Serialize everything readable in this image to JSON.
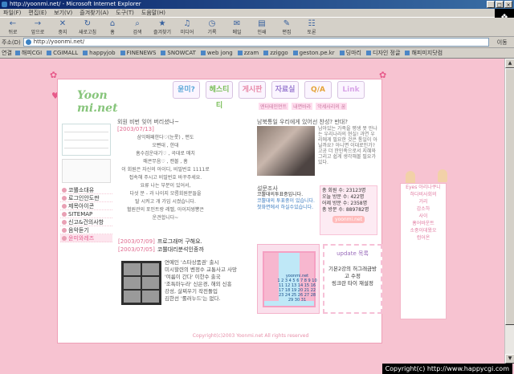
{
  "window": {
    "title": "http://yoonmi.net/ - Microsoft Internet Explorer"
  },
  "menus": [
    "파일(F)",
    "편집(E)",
    "보기(V)",
    "즐겨찾기(A)",
    "도구(T)",
    "도움말(H)"
  ],
  "toolbar": [
    {
      "label": "뒤로",
      "icon": "back-arrow-icon"
    },
    {
      "label": "앞으로",
      "icon": "forward-arrow-icon"
    },
    {
      "label": "중지",
      "icon": "stop-icon"
    },
    {
      "label": "새로고침",
      "icon": "refresh-icon"
    },
    {
      "label": "홈",
      "icon": "home-icon"
    },
    {
      "label": "검색",
      "icon": "search-icon"
    },
    {
      "label": "즐겨찾기",
      "icon": "favorites-icon"
    },
    {
      "label": "미디어",
      "icon": "media-icon"
    },
    {
      "label": "기록",
      "icon": "history-icon"
    },
    {
      "label": "메일",
      "icon": "mail-icon"
    },
    {
      "label": "인쇄",
      "icon": "print-icon"
    },
    {
      "label": "편집",
      "icon": "edit-icon"
    },
    {
      "label": "토론",
      "icon": "discuss-icon"
    }
  ],
  "address": {
    "label": "주소(D)",
    "value": "http://yoonmi.net/",
    "go": "이동"
  },
  "links": {
    "label": "연결",
    "items": [
      "해피CGI",
      "CGIMALL",
      "happyjob",
      "FINENEWS",
      "SNOWCAT",
      "web jong",
      "zzam",
      "zziggo",
      "geston.pe.kr",
      "딩마리",
      "디자인 정글",
      "해피미지닷컴"
    ]
  },
  "site": {
    "logo": "Yoon mi.net",
    "nav": [
      "윤미?",
      "헤스티티",
      "게시판",
      "자료실",
      "Q/A",
      "Link"
    ],
    "subnav": [
      "엔터테인먼트",
      "내면바라",
      "악세사리의 꿈"
    ],
    "menu": [
      "코뿔소대유",
      "로그인안도판",
      "제목아이콘",
      "SITEMAP",
      "신고&건의사항",
      "음악듣기",
      "윤미와레즈"
    ],
    "news": {
      "title": "외원 비번 잊어 버리셨나~",
      "date": "[2003/07/13]",
      "lines": [
        "삼익매패한다♡(눈롯) , 편도",
        "오빤대 , 한대",
        "흠수검운대기♡ , 곡대로 매치",
        "매콘무음♡ , 캔볼 , 흠",
        "이 회원은 자신의 아이디, 비밀번호 1111로",
        "접속해 주시고 비밀번호 바꾸주세요.",
        "요류 나는 부분이 있어서,",
        "다섯 분 - 과 나이지 모름회원분들을",
        "탈 시켜고 개 가입 시켰습니다.",
        "혈원관의 포인트랑 레벨, 아이지썽뽕은",
        "운견합니다~"
      ]
    },
    "feature": {
      "title": "남북통일 우리에게 있어선 찬성? 반대?",
      "text": [
        "남아있는 가족을 평생 못 만나는 우리나라의 현실! 과연 우리에게 필요한 것은 통일이 아닐까요? 아니면 이대로인가? 고공 더 한민족으로서 지혜와 그리고 쉽게 생각해볼 필요가 있다."
      ]
    },
    "poll": {
      "title": "설문조사",
      "question": "코뿔대의투표중입니다.",
      "result": "코뿔대의 투표중이 있습니다. 첫화면에서 하실수있습니다."
    },
    "stats": [
      {
        "label": "총 회원 수",
        "value": "23123명"
      },
      {
        "label": "오늘 방문 수",
        "value": "422명"
      },
      {
        "label": "어제 방문 수",
        "value": "2358명"
      },
      {
        "label": "총 방문 수",
        "value": "889782명"
      }
    ],
    "stats_button": "yoonmi.net",
    "qa": [
      {
        "date": "[2003/07/09]",
        "text": "프로그래머 구해요."
      },
      {
        "date": "[2003/07/05]",
        "text": "코뿔대리분석인종까"
      }
    ],
    "gallery": [
      "연예인 '스타상품권' 출시",
      "미시할련의 벤정수 교통사고 사망",
      "'여름이 간다' 이한수 출국",
      "'조특마누라' 신은경, 해외 신흥",
      "강성, 살찌우기 작전돌입",
      "김한선 '롤러누드'는 없다."
    ],
    "calendar": {
      "month": "yoonmi.net",
      "days": "1 2 3 4 5 6 7 8 9 10 11 12 13 14 15 16 17 18 19 20 21 22 23 24 25 26 27 28 29 30 31"
    },
    "update": {
      "title": "update 목록",
      "lines": [
        "기본2강의 허그래금방",
        "고 수정",
        "링크란 타이 재설정"
      ]
    },
    "footer": "Copyright(c)2003 Yoonmi.net All rights reserved",
    "side": [
      "Eyes 아리나쿠니",
      "하다비사회의",
      "거리",
      "감소하",
      "사이",
      "홈어바운트",
      "소중이데왔오",
      "컴어온"
    ]
  },
  "watermark": "Copyright(c) http://www.happycgi.com"
}
